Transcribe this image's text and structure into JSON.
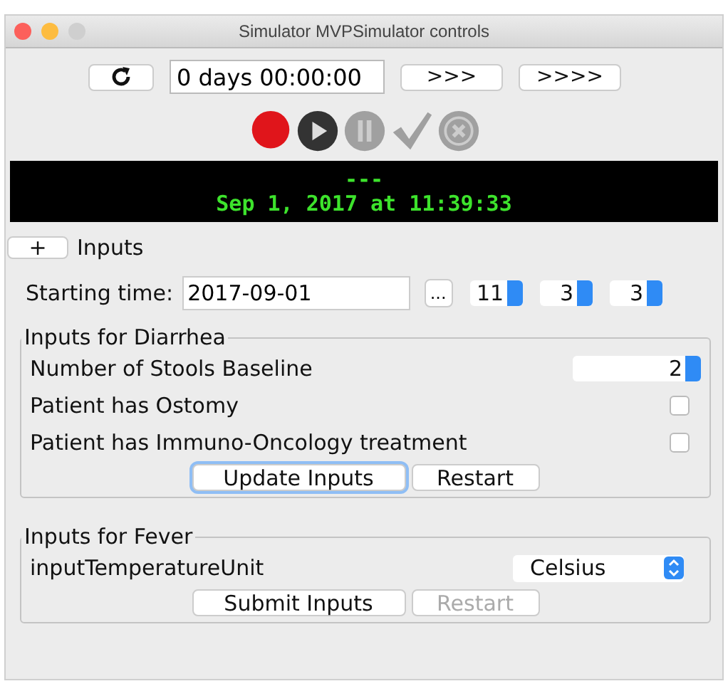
{
  "window": {
    "title": "Simulator MVPSimulator controls"
  },
  "toolbar": {
    "elapsed": "0 days 00:00:00",
    "buttons": [
      {
        "kind": "refresh"
      },
      {
        "kind": "text",
        "label": ">>>"
      },
      {
        "kind": "text",
        "label": ">>>>"
      }
    ]
  },
  "media_buttons": [
    {
      "kind": "record",
      "disabled": false
    },
    {
      "kind": "play",
      "disabled": false
    },
    {
      "kind": "pause",
      "disabled": true
    },
    {
      "kind": "check",
      "disabled": true
    },
    {
      "kind": "cancel",
      "disabled": true
    }
  ],
  "display": {
    "line_1": "---",
    "line_2": "Sep 1, 2017 at 11:39:33"
  },
  "inputs_toggle": {
    "button": "+",
    "label": "Inputs"
  },
  "starting_time": {
    "label": "Starting time:",
    "date": "2017-09-01",
    "picker": "...",
    "hour": "11",
    "minute": "3",
    "second": "3"
  },
  "groups": [
    {
      "title": "Inputs for Diarrhea",
      "rows": [
        {
          "kind": "number",
          "label": "Number of Stools Baseline",
          "value": "2"
        },
        {
          "kind": "checkbox",
          "label": "Patient has Ostomy",
          "checked": false
        },
        {
          "kind": "checkbox",
          "label": "Patient has Immuno-Oncology treatment",
          "checked": false
        }
      ],
      "buttons": [
        {
          "label": "Update Inputs",
          "focused": true,
          "disabled": false
        },
        {
          "label": "Restart",
          "focused": false,
          "disabled": false
        }
      ]
    },
    {
      "title": "Inputs for Fever",
      "rows": [
        {
          "kind": "select",
          "label": "inputTemperatureUnit",
          "value": "Celsius"
        }
      ],
      "buttons": [
        {
          "label": "Submit Inputs",
          "focused": false,
          "disabled": false
        },
        {
          "label": "Restart",
          "focused": false,
          "disabled": true
        }
      ]
    }
  ]
}
